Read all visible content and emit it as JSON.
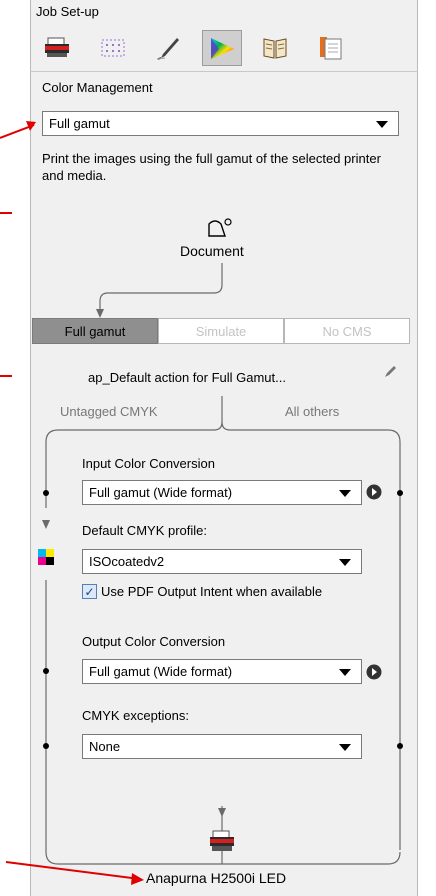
{
  "header": {
    "title": "Job Set-up"
  },
  "toolbar": {
    "icons": [
      "printer-icon",
      "layout-grid-icon",
      "pen-icon",
      "color-icon",
      "book-icon",
      "document-icon"
    ],
    "active_index": 3
  },
  "color_management": {
    "label": "Color Management",
    "mode": "Full gamut",
    "description": "Print the images using the full gamut of the selected printer and media."
  },
  "document_label": "Document",
  "tabs": [
    {
      "label": "Full gamut",
      "active": true
    },
    {
      "label": "Simulate",
      "active": false
    },
    {
      "label": "No CMS",
      "active": false
    }
  ],
  "action_label": "ap_Default action for Full Gamut...",
  "branches": {
    "left": "Untagged CMYK",
    "right": "All others"
  },
  "input_conversion": {
    "label": "Input Color Conversion",
    "value": "Full gamut (Wide format)"
  },
  "default_cmyk": {
    "label": "Default CMYK profile:",
    "value": "ISOcoatedv2"
  },
  "pdf_intent": {
    "label": "Use PDF Output Intent when available",
    "checked": true
  },
  "output_conversion": {
    "label": "Output Color Conversion",
    "value": "Full gamut (Wide format)"
  },
  "cmyk_exceptions": {
    "label": "CMYK exceptions:",
    "value": "None"
  },
  "printer_name": "Anapurna H2500i LED",
  "colors": {
    "panel_bg": "#f0f0f0",
    "annotation": "#e00000",
    "active_tab": "#8f8f8f",
    "line": "#6a6a6a"
  }
}
